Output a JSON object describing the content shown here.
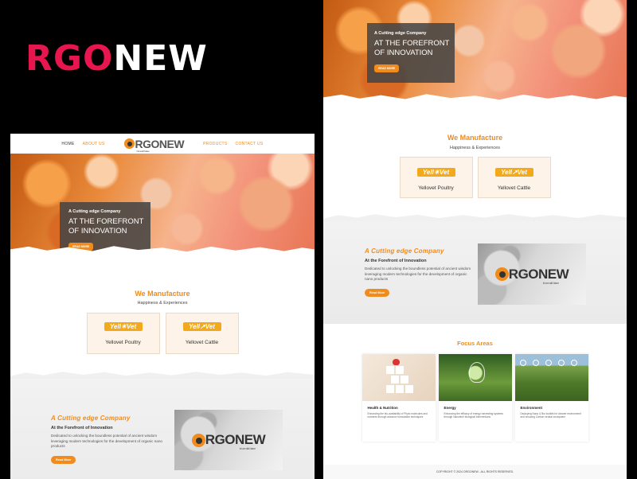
{
  "brand": {
    "highlight": "RGO",
    "rest": "NEW"
  },
  "colors": {
    "accent": "#f08b1c",
    "brand_pink": "#e8164f",
    "card_bg": "#fdf3e8",
    "gray_band": "#f0f0f0"
  },
  "nav": {
    "items_left": [
      "HOME",
      "ABOUT US"
    ],
    "items_right": [
      "PRODUCTS",
      "CONTACT US"
    ],
    "logo_o": "O",
    "logo_text": "RGONEW",
    "logo_tagline": "In tune with Nature"
  },
  "hero": {
    "kicker": "A Cutting edge Company",
    "headline": "AT THE FOREFRONT OF INNOVATION",
    "button": "READ MORE"
  },
  "manufacture": {
    "title": "We Manufacture",
    "subtitle": "Happiness & Experiences",
    "products": [
      {
        "logo": "Yell☀Vet",
        "name": "Yellovet Poultry",
        "logo_icon": "sun-icon"
      },
      {
        "logo": "Yell↗Vet",
        "name": "Yellovet Cattle",
        "logo_icon": "arrow-icon"
      }
    ]
  },
  "about": {
    "title": "A Cutting edge Company",
    "subtitle": "At the Forefront of Innovation",
    "text": "Dedicated to unlocking the boundless potential of ancient wisdom leveraging modern technologies for the development of organic nano products",
    "button": "Read More",
    "logo_o": "O",
    "logo_text": "RGONEW",
    "logo_tagline": "In tune with Nature"
  },
  "focus": {
    "title": "Focus Areas",
    "cards": [
      {
        "title": "Health & Nutrition",
        "text": "Enhancing the bio-availability of Phyto molecules and nutrients through advance formulation techniques",
        "image": "health-blocks-image"
      },
      {
        "title": "Energy",
        "text": "Enhancing the efficacy of energy harvesting systems through Nanotech biological interventions",
        "image": "bulb-plant-image"
      },
      {
        "title": "Environment",
        "text": "Deploying Nano & Bio toolkits for cleaner environment and ensuring Carbon neutral ecosystem",
        "image": "field-icons-image"
      }
    ]
  },
  "footer": {
    "text": "COPYRIGHT © 2024 ORGONEW - ALL RIGHTS RESERVED."
  }
}
